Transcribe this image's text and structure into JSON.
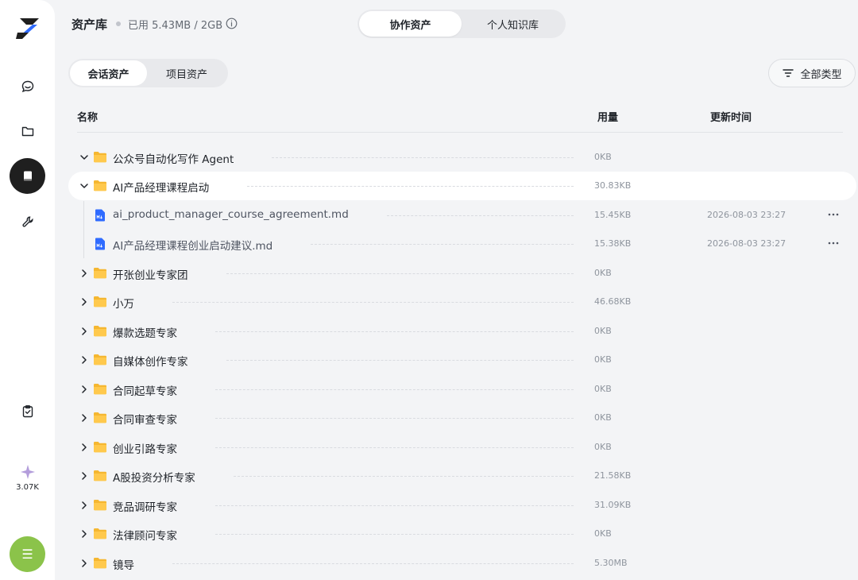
{
  "header": {
    "title": "资产库",
    "usage": "已用 5.43MB / 2GB",
    "tabs": [
      {
        "label": "协作资产",
        "active": true
      },
      {
        "label": "个人知识库",
        "active": false
      }
    ]
  },
  "subtabs": [
    {
      "label": "会话资产",
      "active": true
    },
    {
      "label": "项目资产",
      "active": false
    }
  ],
  "filter_label": "全部类型",
  "columns": {
    "name": "名称",
    "size": "用量",
    "time": "更新时间"
  },
  "credits": "3.07K",
  "colors": {
    "accent_green": "#8bc34a",
    "folder": "#f5b731",
    "file_blue": "#2f6bff",
    "active_nav": "#1f1f1f"
  },
  "rows": [
    {
      "type": "folder",
      "expanded": true,
      "name": "公众号自动化写作 Agent",
      "size": "0KB"
    },
    {
      "type": "folder",
      "expanded": true,
      "name": "AI产品经理课程启动",
      "size": "30.83KB"
    },
    {
      "type": "file",
      "name": "ai_product_manager_course_agreement.md",
      "size": "15.45KB",
      "time": "2026-08-03 23:27"
    },
    {
      "type": "file",
      "name": "AI产品经理课程创业启动建议.md",
      "size": "15.38KB",
      "time": "2026-08-03 23:27"
    },
    {
      "type": "folder",
      "expanded": false,
      "name": "开张创业专家团",
      "size": "0KB"
    },
    {
      "type": "folder",
      "expanded": false,
      "name": "小万",
      "size": "46.68KB"
    },
    {
      "type": "folder",
      "expanded": false,
      "name": "爆款选题专家",
      "size": "0KB"
    },
    {
      "type": "folder",
      "expanded": false,
      "name": "自媒体创作专家",
      "size": "0KB"
    },
    {
      "type": "folder",
      "expanded": false,
      "name": "合同起草专家",
      "size": "0KB"
    },
    {
      "type": "folder",
      "expanded": false,
      "name": "合同审查专家",
      "size": "0KB"
    },
    {
      "type": "folder",
      "expanded": false,
      "name": "创业引路专家",
      "size": "0KB"
    },
    {
      "type": "folder",
      "expanded": false,
      "name": "A股投资分析专家",
      "size": "21.58KB"
    },
    {
      "type": "folder",
      "expanded": false,
      "name": "竞品调研专家",
      "size": "31.09KB"
    },
    {
      "type": "folder",
      "expanded": false,
      "name": "法律顾问专家",
      "size": "0KB"
    },
    {
      "type": "folder",
      "expanded": false,
      "name": "镜导",
      "size": "5.30MB"
    }
  ]
}
